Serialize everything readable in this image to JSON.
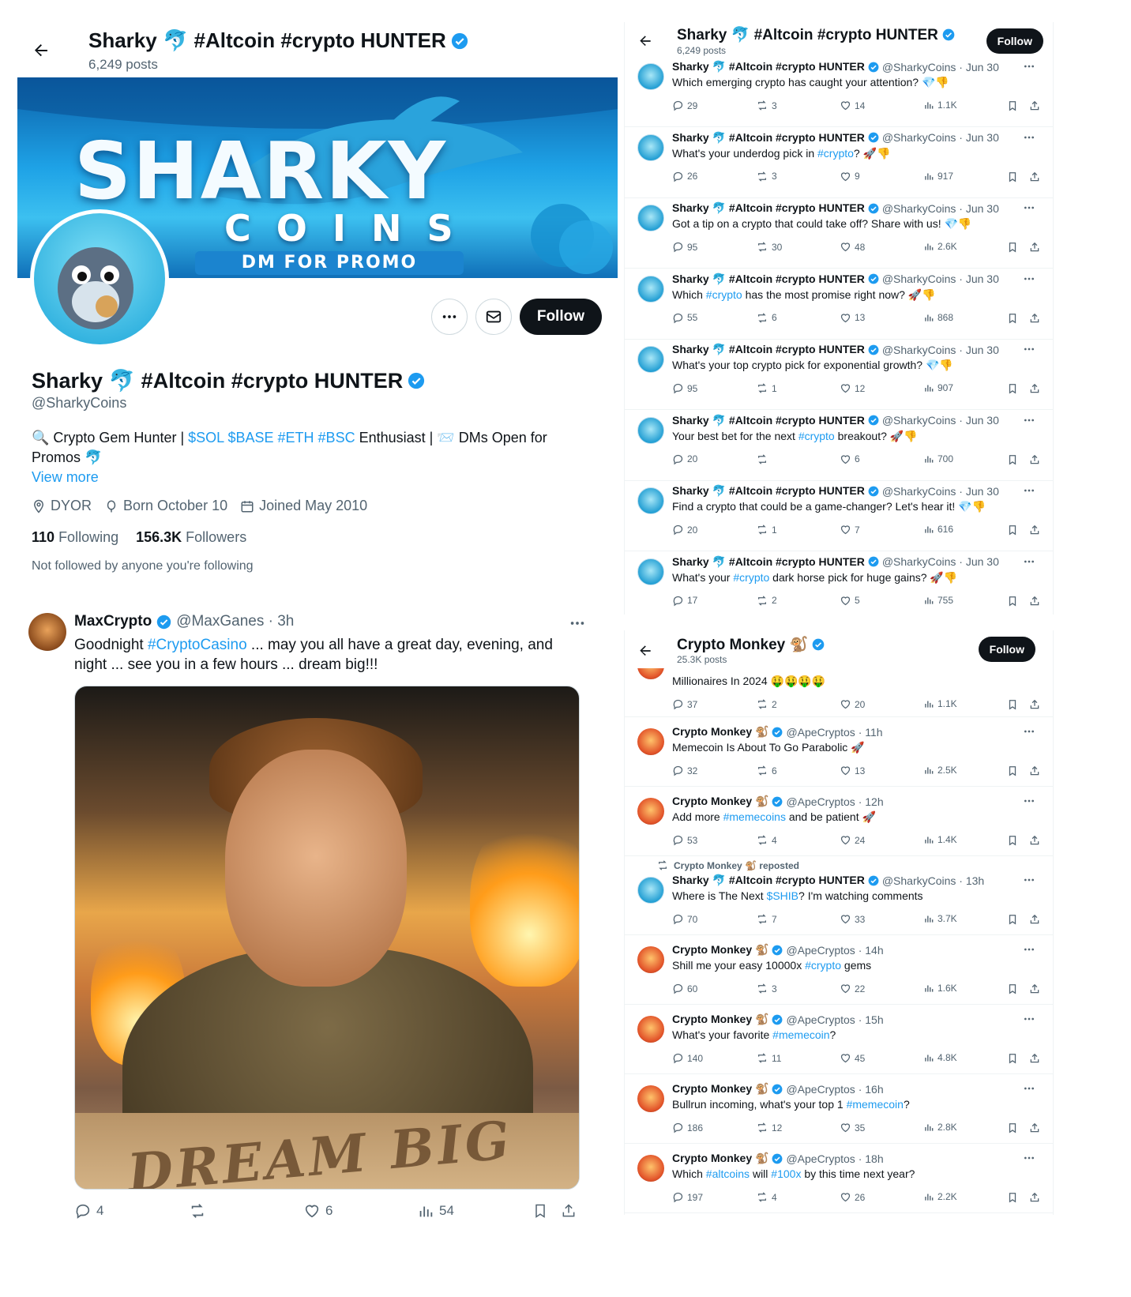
{
  "left": {
    "header": {
      "title": "Sharky 🐬 #Altcoin #crypto HUNTER",
      "posts": "6,249 posts"
    },
    "banner": {
      "word": "SHARKY",
      "sub": "COINS",
      "promo": "DM FOR PROMO"
    },
    "actions": {
      "follow": "Follow"
    },
    "profile": {
      "name": "Sharky 🐬 #Altcoin #crypto HUNTER",
      "handle": "@SharkyCoins",
      "bio_1": "🔍 Crypto Gem Hunter | ",
      "bio_tags": "$SOL $BASE #ETH #BSC",
      "bio_2": " Enthusiast | 📨 DMs Open for Promos 🐬",
      "view_more": "View more",
      "location": "DYOR",
      "born": "Born October 10",
      "joined": "Joined May 2010",
      "following_count": "110",
      "following_label": "Following",
      "followers_count": "156.3K",
      "followers_label": "Followers",
      "not_followed": "Not followed by anyone you're following"
    },
    "tweet": {
      "name": "MaxCrypto",
      "handle": "@MaxGanes · 3h",
      "text_1": "Goodnight ",
      "text_tag": "#CryptoCasino",
      "text_2": " ... may you all have a great day, evening, and night ... see you in a few hours ... dream big!!!",
      "image_text": "DREAM BIG",
      "replies": "4",
      "reposts": "",
      "likes": "6",
      "views": "54"
    }
  },
  "panelA": {
    "title": "Sharky 🐬 #Altcoin #crypto HUNTER",
    "posts": "6,249 posts",
    "follow": "Follow",
    "tweets": [
      {
        "name": "Sharky 🐬 #Altcoin #crypto HUNTER",
        "meta": "@SharkyCoins · Jun 30",
        "t1": "Which emerging crypto has caught your attention? 💎👎",
        "tag": "",
        "t2": "",
        "replies": "29",
        "reposts": "3",
        "likes": "14",
        "views": "1.1K"
      },
      {
        "name": "Sharky 🐬 #Altcoin #crypto HUNTER",
        "meta": "@SharkyCoins · Jun 30",
        "t1": "What's your underdog pick in ",
        "tag": "#crypto",
        "t2": "? 🚀👎",
        "replies": "26",
        "reposts": "3",
        "likes": "9",
        "views": "917"
      },
      {
        "name": "Sharky 🐬 #Altcoin #crypto HUNTER",
        "meta": "@SharkyCoins · Jun 30",
        "t1": "Got a tip on a crypto that could take off? Share with us! 💎👎",
        "tag": "",
        "t2": "",
        "replies": "95",
        "reposts": "30",
        "likes": "48",
        "views": "2.6K"
      },
      {
        "name": "Sharky 🐬 #Altcoin #crypto HUNTER",
        "meta": "@SharkyCoins · Jun 30",
        "t1": "Which ",
        "tag": "#crypto",
        "t2": " has the most promise right now? 🚀👎",
        "replies": "55",
        "reposts": "6",
        "likes": "13",
        "views": "868"
      },
      {
        "name": "Sharky 🐬 #Altcoin #crypto HUNTER",
        "meta": "@SharkyCoins · Jun 30",
        "t1": "What's your top crypto pick for exponential growth? 💎👎",
        "tag": "",
        "t2": "",
        "replies": "95",
        "reposts": "1",
        "likes": "12",
        "views": "907"
      },
      {
        "name": "Sharky 🐬 #Altcoin #crypto HUNTER",
        "meta": "@SharkyCoins · Jun 30",
        "t1": "Your best bet for the next ",
        "tag": "#crypto",
        "t2": " breakout? 🚀👎",
        "replies": "20",
        "reposts": "",
        "likes": "6",
        "views": "700"
      },
      {
        "name": "Sharky 🐬 #Altcoin #crypto HUNTER",
        "meta": "@SharkyCoins · Jun 30",
        "t1": "Find a crypto that could be a game-changer? Let's hear it! 💎👎",
        "tag": "",
        "t2": "",
        "replies": "20",
        "reposts": "1",
        "likes": "7",
        "views": "616"
      },
      {
        "name": "Sharky 🐬 #Altcoin #crypto HUNTER",
        "meta": "@SharkyCoins · Jun 30",
        "t1": "What's your ",
        "tag": "#crypto",
        "t2": " dark horse pick for huge gains? 🚀👎",
        "replies": "17",
        "reposts": "2",
        "likes": "5",
        "views": "755"
      }
    ]
  },
  "panelB": {
    "title": "Crypto Monkey 🐒",
    "posts": "25.3K posts",
    "follow": "Follow",
    "first": {
      "text": "Millionaires In 2024 🤑🤑🤑🤑",
      "replies": "37",
      "reposts": "2",
      "likes": "20",
      "views": "1.1K"
    },
    "repost_note": "Crypto Monkey 🐒 reposted",
    "tweets": [
      {
        "name": "Crypto Monkey 🐒",
        "meta": "@ApeCryptos · 11h",
        "t1": "Memecoin Is About To Go Parabolic 🚀",
        "tag": "",
        "t2": "",
        "replies": "32",
        "reposts": "6",
        "likes": "13",
        "views": "2.5K",
        "av": "monkey"
      },
      {
        "name": "Crypto Monkey 🐒",
        "meta": "@ApeCryptos · 12h",
        "t1": "Add more ",
        "tag": "#memecoins",
        "t2": " and be patient 🚀",
        "replies": "53",
        "reposts": "4",
        "likes": "24",
        "views": "1.4K",
        "av": "monkey"
      },
      {
        "name": "Sharky 🐬 #Altcoin #crypto HUNTER",
        "meta": "@SharkyCoins · 13h",
        "t1": "Where is The Next ",
        "tag": "$SHIB",
        "t2": "? I'm watching comments",
        "replies": "70",
        "reposts": "7",
        "likes": "33",
        "views": "3.7K",
        "av": "shark"
      },
      {
        "name": "Crypto Monkey 🐒",
        "meta": "@ApeCryptos · 14h",
        "t1": "Shill me your easy 10000x ",
        "tag": "#crypto",
        "t2": " gems",
        "replies": "60",
        "reposts": "3",
        "likes": "22",
        "views": "1.6K",
        "av": "monkey"
      },
      {
        "name": "Crypto Monkey 🐒",
        "meta": "@ApeCryptos · 15h",
        "t1": "What's your favorite ",
        "tag": "#memecoin",
        "t2": "?",
        "replies": "140",
        "reposts": "11",
        "likes": "45",
        "views": "4.8K",
        "av": "monkey"
      },
      {
        "name": "Crypto Monkey 🐒",
        "meta": "@ApeCryptos · 16h",
        "t1": "Bullrun incoming, what's your top 1 ",
        "tag": "#memecoin",
        "t2": "?",
        "replies": "186",
        "reposts": "12",
        "likes": "35",
        "views": "2.8K",
        "av": "monkey"
      },
      {
        "name": "Crypto Monkey 🐒",
        "meta": "@ApeCryptos · 18h",
        "t1": "Which ",
        "tag": "#altcoins",
        "t2": " will ",
        "replies": "197",
        "reposts": "4",
        "likes": "26",
        "views": "2.2K",
        "av": "monkey",
        "tag2": "#100x",
        "t3": " by this time next year?"
      }
    ]
  },
  "icons": {
    "back": "arrow-left-icon",
    "more": "more-icon",
    "mail": "mail-icon",
    "verified": "verified-badge-icon",
    "reply": "reply-icon",
    "repost": "repost-icon",
    "like": "like-icon",
    "views": "views-icon",
    "bookmark": "bookmark-icon",
    "share": "share-icon",
    "location": "location-icon",
    "birthday": "birthday-icon",
    "calendar": "calendar-icon"
  },
  "colors": {
    "accent": "#1d9bf0",
    "text": "#0f1419",
    "muted": "#536471",
    "button": "#0f1419"
  }
}
